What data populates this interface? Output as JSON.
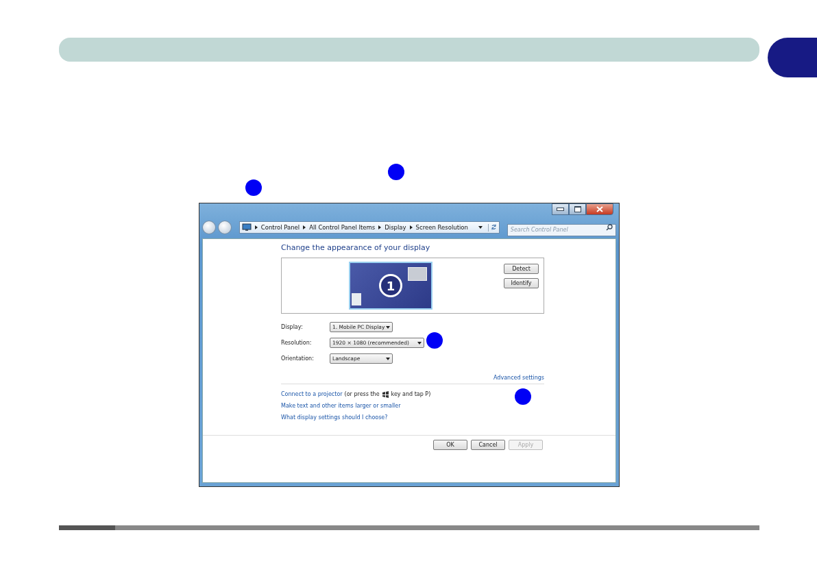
{
  "address_bar": {
    "breadcrumbs": [
      "Control Panel",
      "All Control Panel Items",
      "Display",
      "Screen Resolution"
    ]
  },
  "search": {
    "placeholder": "Search Control Panel"
  },
  "heading": "Change the appearance of your display",
  "monitor": {
    "number": "1"
  },
  "side_buttons": [
    "Detect",
    "Identify"
  ],
  "settings": [
    {
      "label": "Display:",
      "value": "1. Mobile PC Display"
    },
    {
      "label": "Resolution:",
      "value": "1920 × 1080 (recommended)"
    },
    {
      "label": "Orientation:",
      "value": "Landscape"
    }
  ],
  "advanced_link": "Advanced settings",
  "projector": {
    "link": "Connect to a projector",
    "before_key": "(or press the",
    "after_key": "key and tap P)"
  },
  "links": [
    "Make text and other items larger or smaller",
    "What display settings should I choose?"
  ],
  "buttons": [
    {
      "label": "OK",
      "disabled": false
    },
    {
      "label": "Cancel",
      "disabled": false
    },
    {
      "label": "Apply",
      "disabled": true
    }
  ]
}
